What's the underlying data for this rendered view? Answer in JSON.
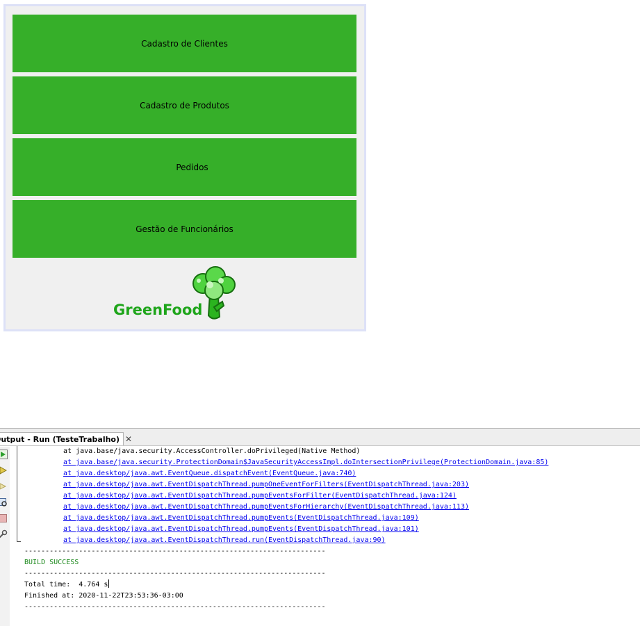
{
  "app": {
    "menu": [
      {
        "label": "Cadastro de Clientes"
      },
      {
        "label": "Cadastro de Produtos"
      },
      {
        "label": "Pedidos"
      },
      {
        "label": "Gestão de Funcionários"
      }
    ],
    "logo_text": "GreenFood",
    "colors": {
      "button": "#36af29",
      "logo": "#1ea51a"
    }
  },
  "output": {
    "tab_label": "Output - Run (TesteTrabalho)",
    "close_glyph": "✕",
    "toolbar_icons": [
      "run-icon",
      "rerun-icon",
      "rerun-step-icon",
      "inspect-icon",
      "stop-icon",
      "settings-icon"
    ],
    "trace_lines": [
      {
        "text": "at java.base/java.security.AccessController.doPrivileged(Native Method)",
        "link": false
      },
      {
        "text": "at java.base/java.security.ProtectionDomain$JavaSecurityAccessImpl.doIntersectionPrivilege(ProtectionDomain.java:85)",
        "link": true
      },
      {
        "text": "at java.desktop/java.awt.EventQueue.dispatchEvent(EventQueue.java:740)",
        "link": true
      },
      {
        "text": "at java.desktop/java.awt.EventDispatchThread.pumpOneEventForFilters(EventDispatchThread.java:203)",
        "link": true
      },
      {
        "text": "at java.desktop/java.awt.EventDispatchThread.pumpEventsForFilter(EventDispatchThread.java:124)",
        "link": true
      },
      {
        "text": "at java.desktop/java.awt.EventDispatchThread.pumpEventsForHierarchy(EventDispatchThread.java:113)",
        "link": true
      },
      {
        "text": "at java.desktop/java.awt.EventDispatchThread.pumpEvents(EventDispatchThread.java:109)",
        "link": true
      },
      {
        "text": "at java.desktop/java.awt.EventDispatchThread.pumpEvents(EventDispatchThread.java:101)",
        "link": true
      },
      {
        "text": "at java.desktop/java.awt.EventDispatchThread.run(EventDispatchThread.java:90)",
        "link": true
      }
    ],
    "separator": "------------------------------------------------------------------------",
    "build_status": "BUILD SUCCESS",
    "total_time": "Total time:  4.764 s",
    "finished_at": "Finished at: 2020-11-22T23:53:36-03:00"
  }
}
